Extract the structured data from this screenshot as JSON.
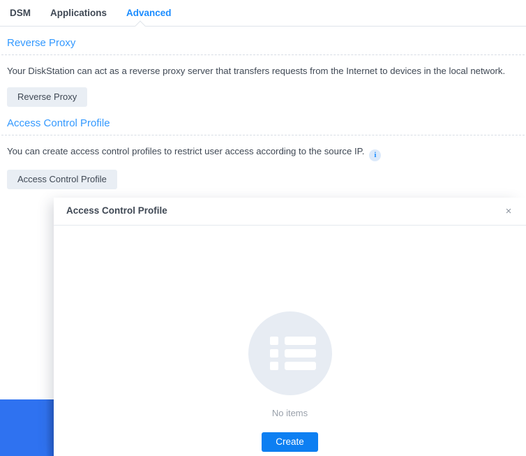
{
  "tabs": [
    {
      "label": "DSM",
      "active": false
    },
    {
      "label": "Applications",
      "active": false
    },
    {
      "label": "Advanced",
      "active": true
    }
  ],
  "sections": [
    {
      "heading": "Reverse Proxy",
      "description": "Your DiskStation can act as a reverse proxy server that transfers requests from the Internet to devices in the local network.",
      "button": "Reverse Proxy"
    },
    {
      "heading": "Access Control Profile",
      "description": "You can create access control profiles to restrict user access according to the source IP.",
      "info_icon": "info-icon",
      "info_glyph": "i",
      "button": "Access Control Profile"
    }
  ],
  "modal": {
    "title": "Access Control Profile",
    "close_glyph": "×",
    "close_icon": "close-icon",
    "empty_icon": "list-icon",
    "empty_text": "No items",
    "create_label": "Create"
  },
  "colors": {
    "accent": "#1a8cff",
    "heading": "#3399ff",
    "primary_button": "#0d7ff2",
    "grey_button": "#e9eef4",
    "empty_circle": "#e7ecf3",
    "blue_block": "#2f72f0",
    "text": "#3f4854",
    "muted_text": "#9aa1ab"
  }
}
